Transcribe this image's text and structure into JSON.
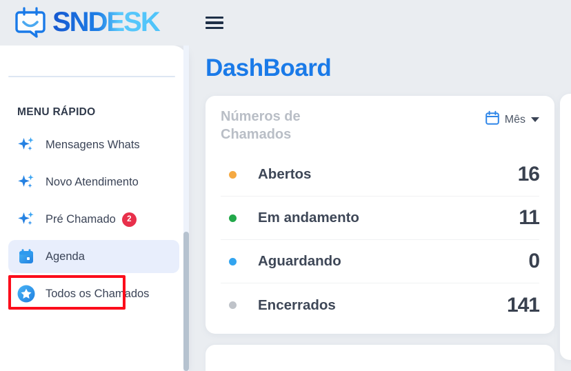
{
  "brand": {
    "name": "SNDESK",
    "logo_icon": "calendar-chat-smile-logo",
    "wordmark_text": "SNDESK",
    "color_dark": "#1565d8",
    "color_light": "#4fc3f7"
  },
  "topbar": {
    "menu_toggle_icon": "hamburger-menu-icon"
  },
  "sidebar": {
    "heading": "MENU RÁPIDO",
    "items": [
      {
        "label": "Mensagens Whats",
        "icon": "sparkle-icon",
        "badge": null,
        "active": false
      },
      {
        "label": "Novo Atendimento",
        "icon": "sparkle-icon",
        "badge": null,
        "active": false
      },
      {
        "label": "Pré Chamado",
        "icon": "sparkle-icon",
        "badge": "2",
        "active": false
      },
      {
        "label": "Agenda",
        "icon": "calendar-icon",
        "badge": null,
        "active": true
      },
      {
        "label": "Todos os Chamados",
        "icon": "star-circle-icon",
        "badge": null,
        "active": false
      }
    ],
    "badge_color": "#e8304b",
    "active_bg": "#e8eefc",
    "annotation_color": "#fc0d1b"
  },
  "main": {
    "page_title": "DashBoard",
    "page_title_color": "#1a7ae8",
    "card": {
      "title": "Números de Chamados",
      "period": {
        "icon": "calendar-icon",
        "label": "Mês",
        "caret_icon": "chevron-down-icon"
      },
      "stats": [
        {
          "label": "Abertos",
          "value": "16",
          "color": "#f5a council"
        },
        {
          "label": "Em andamento",
          "value": "11",
          "color": "#22a84a"
        },
        {
          "label": "Aguardando",
          "value": "0",
          "color": "#32a4ef"
        },
        {
          "label": "Encerrados",
          "value": "141",
          "color": "#bfc3c9"
        }
      ]
    }
  },
  "colors": {
    "page_bg": "#eaedf1",
    "card_bg": "#ffffff",
    "stat_abertos": "#f5a942",
    "stat_andamento": "#22a84a",
    "stat_aguardando": "#32a4ef",
    "stat_encerrados": "#bfc3c9"
  }
}
